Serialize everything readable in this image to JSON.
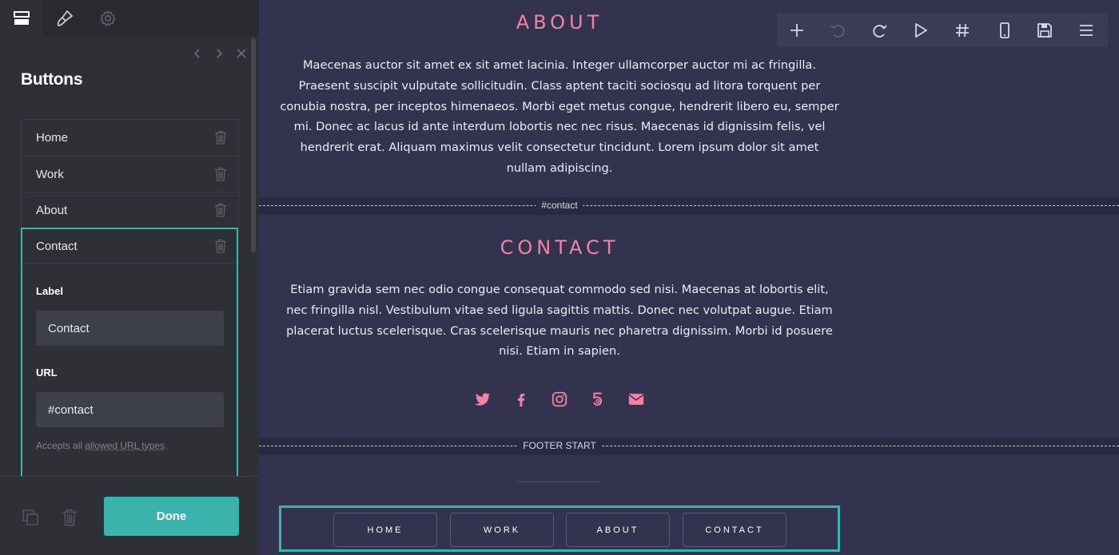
{
  "panel": {
    "tabs": [
      "layout-tab",
      "style-tab",
      "settings-tab"
    ],
    "title": "Buttons",
    "items": [
      {
        "label": "Home"
      },
      {
        "label": "Work"
      },
      {
        "label": "About"
      },
      {
        "label": "Contact"
      }
    ],
    "editor": {
      "label_heading": "Label",
      "label_value": "Contact",
      "url_heading": "URL",
      "url_value": "#contact",
      "hint_prefix": "Accepts all ",
      "hint_link": "allowed URL types",
      "hint_suffix": "."
    },
    "done_label": "Done"
  },
  "canvas": {
    "about": {
      "title": "ABOUT",
      "text": "Maecenas auctor sit amet ex sit amet lacinia. Integer ullamcorper auctor mi ac fringilla. Praesent suscipit vulputate sollicitudin. Class aptent taciti sociosqu ad litora torquent per conubia nostra, per inceptos himenaeos. Morbi eget metus congue, hendrerit libero eu, semper mi. Donec ac lacus id ante interdum lobortis nec nec risus. Maecenas id dignissim felis, vel hendrerit erat. Aliquam maximus velit consectetur tincidunt. Lorem ipsum dolor sit amet nullam adipiscing."
    },
    "divider_contact": "#contact",
    "contact": {
      "title": "CONTACT",
      "text": "Etiam gravida sem nec odio congue consequat commodo sed nisi. Maecenas at lobortis elit, nec fringilla nisl. Vestibulum vitae sed ligula sagittis mattis. Donec nec volutpat augue. Etiam placerat luctus scelerisque. Cras scelerisque mauris nec pharetra dignissim. Morbi id posuere nisi. Etiam in sapien."
    },
    "social_icons": [
      "twitter-icon",
      "facebook-icon",
      "instagram-icon",
      "500px-icon",
      "envelope-icon"
    ],
    "divider_footer": "FOOTER START",
    "footer_nav": [
      "HOME",
      "WORK",
      "ABOUT",
      "CONTACT"
    ]
  },
  "toolbar": {
    "icons": [
      "add-icon",
      "undo-icon",
      "redo-icon",
      "play-icon",
      "anchor-hash-icon",
      "mobile-icon",
      "save-icon",
      "menu-icon"
    ]
  },
  "colors": {
    "accent": "#38b5ad",
    "heading_pink": "#f283a6",
    "canvas_bg": "#34334f",
    "panel_bg": "#2e3035"
  }
}
